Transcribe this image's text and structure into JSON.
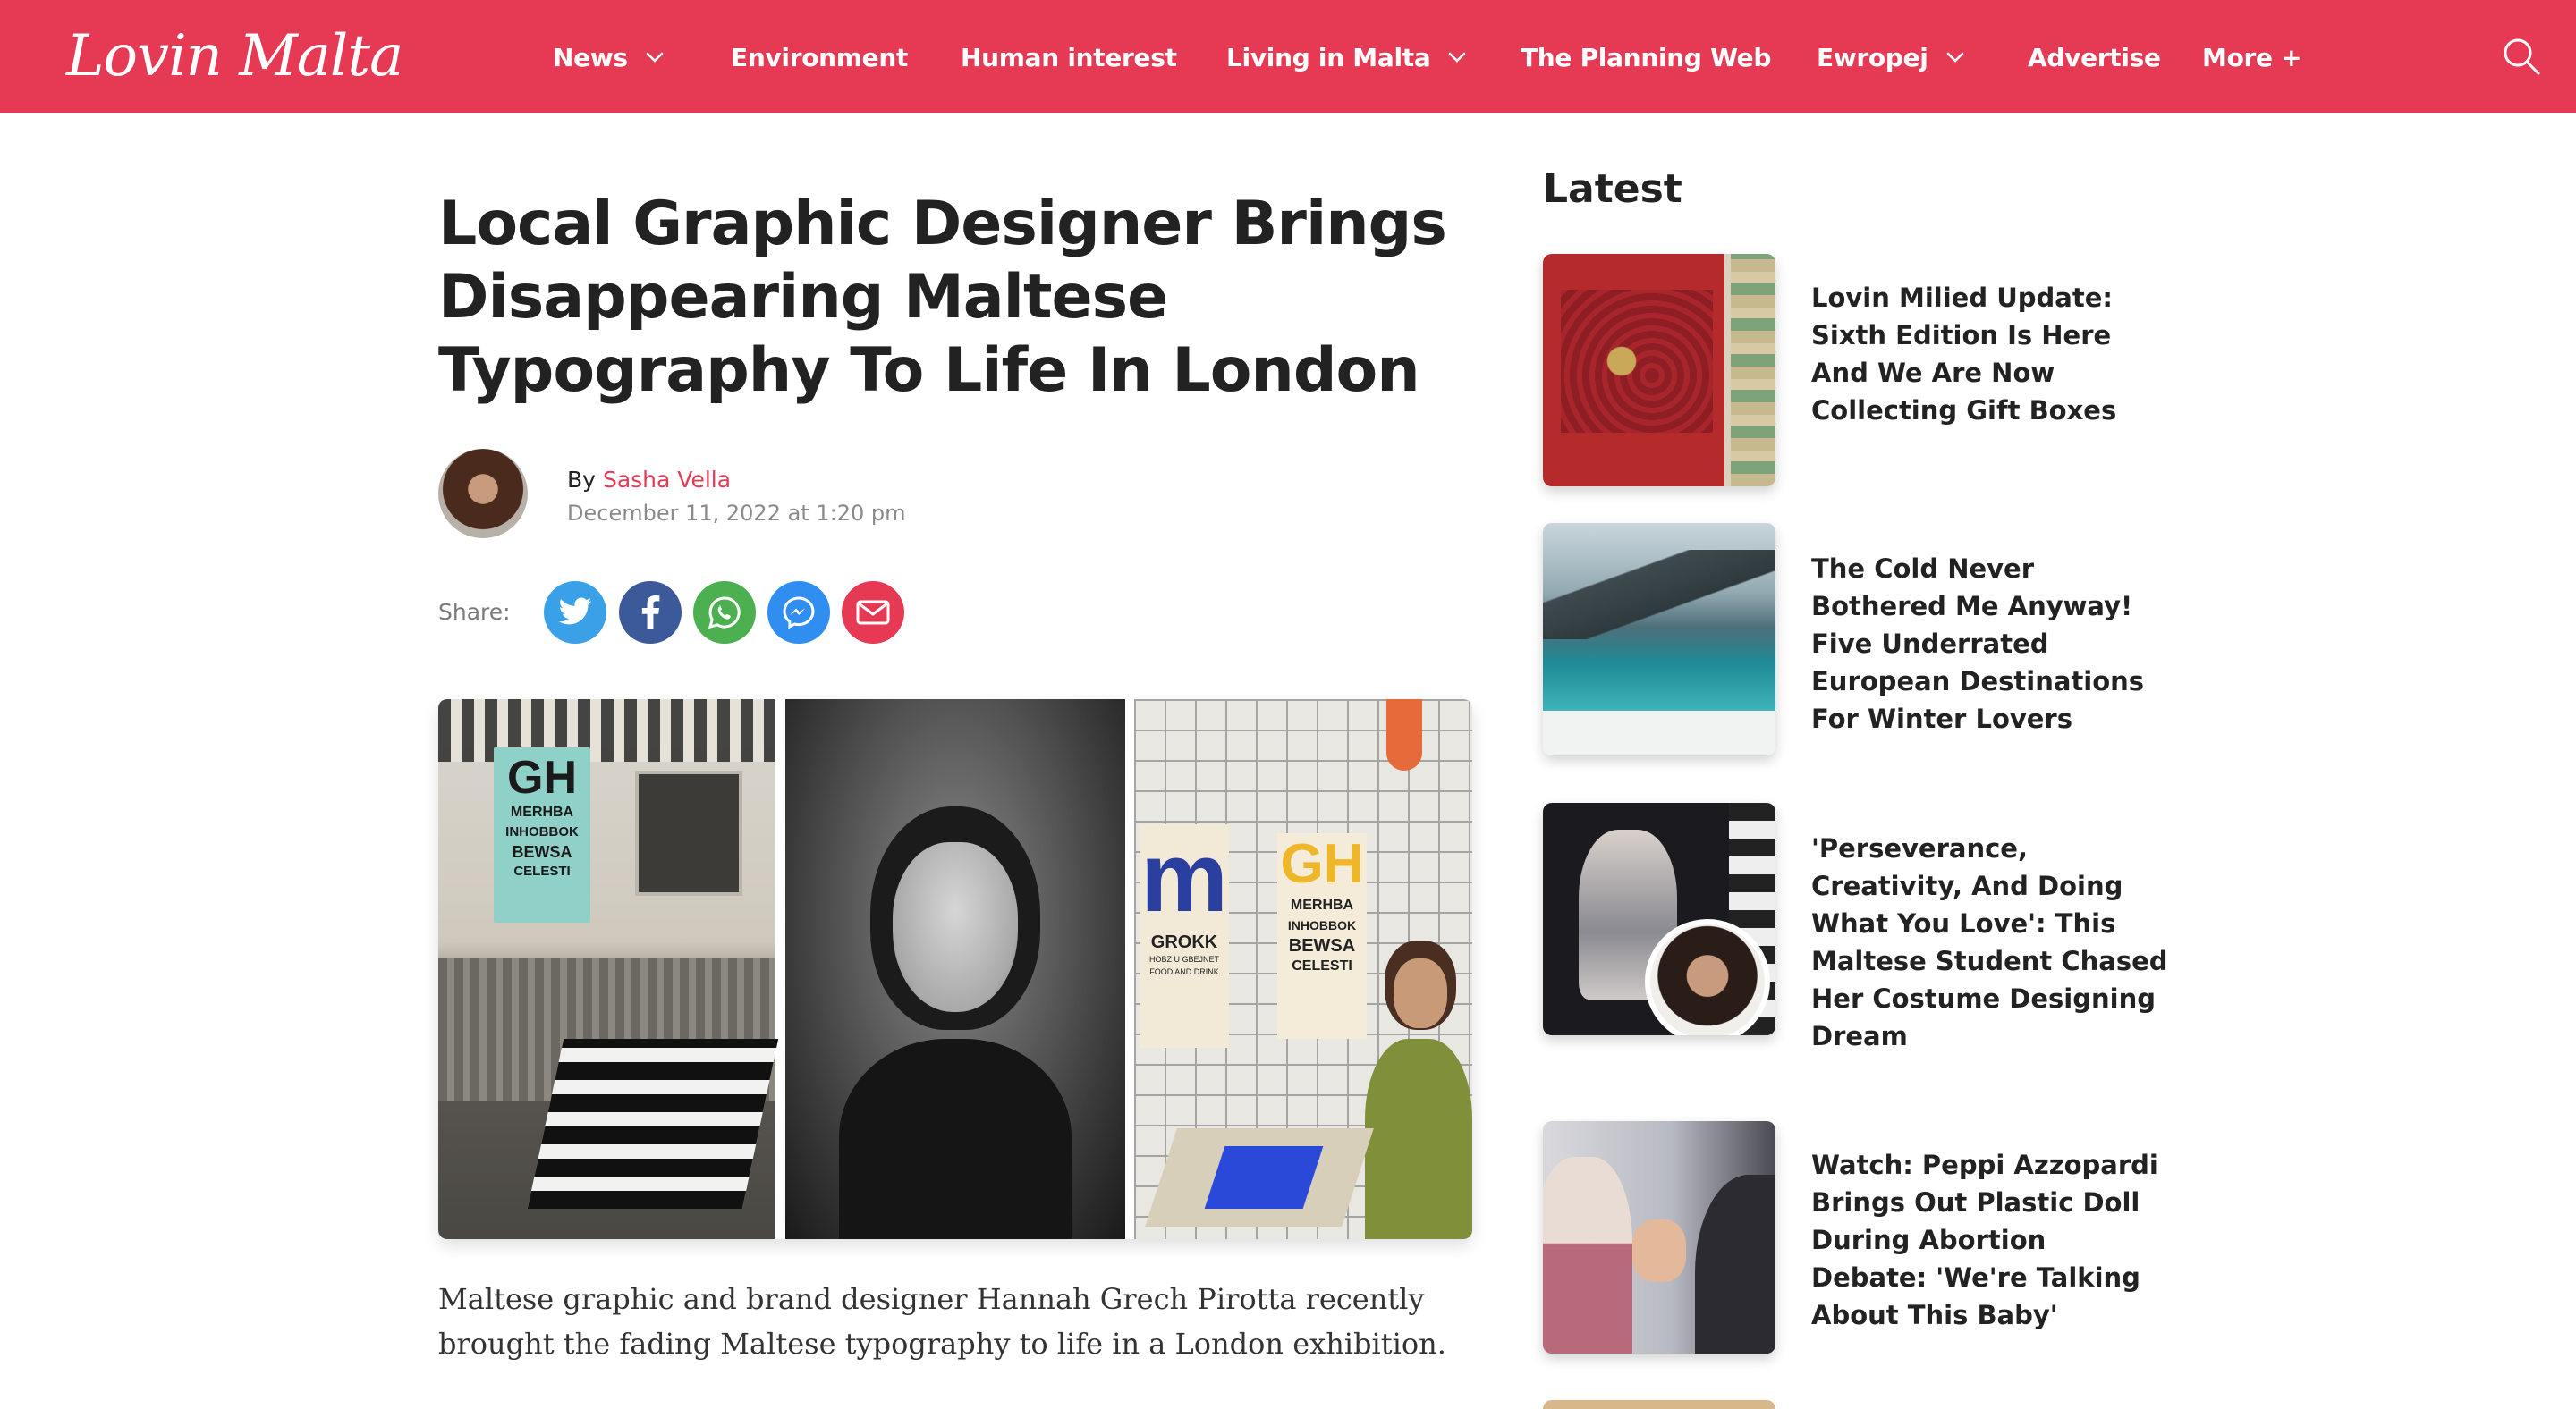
{
  "site": {
    "logo_text": "Lovin Malta",
    "brand_color": "#e63a54"
  },
  "nav": {
    "items": [
      {
        "label": "News",
        "dropdown": true
      },
      {
        "label": "Environment",
        "dropdown": false
      },
      {
        "label": "Human interest",
        "dropdown": false
      },
      {
        "label": "Living in Malta",
        "dropdown": true
      },
      {
        "label": "The Planning Web",
        "dropdown": false
      },
      {
        "label": "Ewropej",
        "dropdown": true
      },
      {
        "label": "Advertise",
        "dropdown": false
      },
      {
        "label": "More +",
        "dropdown": false
      }
    ],
    "search_icon": "search-icon"
  },
  "article": {
    "title": "Local Graphic Designer Brings Disappearing Maltese Typography To Life In London",
    "by_label": "By",
    "author": "Sasha Vella",
    "date": "December 11, 2022 at 1:20 pm",
    "share_label": "Share:",
    "share_buttons": [
      {
        "name": "twitter",
        "icon": "twitter-icon",
        "color": "#3aa1e8"
      },
      {
        "name": "facebook",
        "icon": "facebook-icon",
        "color": "#3c5a9a"
      },
      {
        "name": "whatsapp",
        "icon": "whatsapp-icon",
        "color": "#4caf50"
      },
      {
        "name": "messenger",
        "icon": "messenger-icon",
        "color": "#2f8ef0"
      },
      {
        "name": "email",
        "icon": "email-icon",
        "color": "#e63a54"
      }
    ],
    "hero_image": {
      "poster_lines": [
        "GH",
        "MERHBA",
        "INHOBBOK",
        "BEWSA",
        "CELESTI"
      ],
      "poster2_lines": [
        "GROKK",
        "HOBZ U GBEJNET",
        "FOOD AND DRINK"
      ],
      "letter_m": "m"
    },
    "body": "Maltese graphic and brand designer Hannah Grech Pirotta recently brought the fading Maltese typography to life in a London exhibition."
  },
  "sidebar": {
    "title": "Latest",
    "items": [
      {
        "title": "Lovin Milied Update: Sixth Edition Is Here And We Are Now Collecting Gift Boxes"
      },
      {
        "title": "The Cold Never Bothered Me Anyway! Five Underrated European Destinations For Winter Lovers"
      },
      {
        "title": "'Perseverance, Creativity, And Doing What You Love': This Maltese Student Chased Her Costume Designing Dream"
      },
      {
        "title": "Watch: Peppi Azzopardi Brings Out Plastic Doll During Abortion Debate: 'We're Talking About This Baby'"
      }
    ]
  }
}
